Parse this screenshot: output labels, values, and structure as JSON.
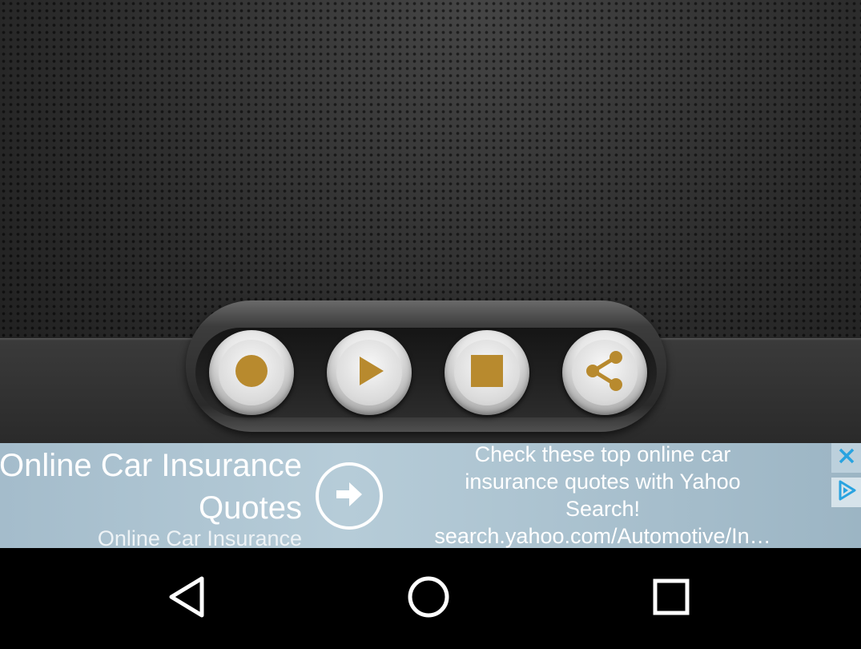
{
  "app": {
    "controls": [
      {
        "name": "record",
        "icon": "record-icon"
      },
      {
        "name": "play",
        "icon": "play-icon"
      },
      {
        "name": "stop",
        "icon": "stop-icon"
      },
      {
        "name": "share",
        "icon": "share-icon"
      }
    ],
    "colors": {
      "accent_gold": "#b88a2e",
      "background": "#2b2b2b"
    }
  },
  "ad": {
    "title": "Online Car Insurance Quotes",
    "subtitle": "Online Car Insurance",
    "description_line1": "Check these top online car",
    "description_line2": "insurance quotes with Yahoo",
    "description_line3": "Search!",
    "url": "search.yahoo.com/Automotive/In…",
    "icons": {
      "arrow": "arrow-right-icon",
      "close": "close-icon",
      "choices": "adchoices-icon"
    },
    "colors": {
      "background": "#b0c6d3",
      "icon_blue": "#29a3e0"
    }
  },
  "nav": {
    "buttons": [
      {
        "name": "back",
        "icon": "back-triangle-icon"
      },
      {
        "name": "home",
        "icon": "home-circle-icon"
      },
      {
        "name": "recents",
        "icon": "recents-square-icon"
      }
    ]
  }
}
